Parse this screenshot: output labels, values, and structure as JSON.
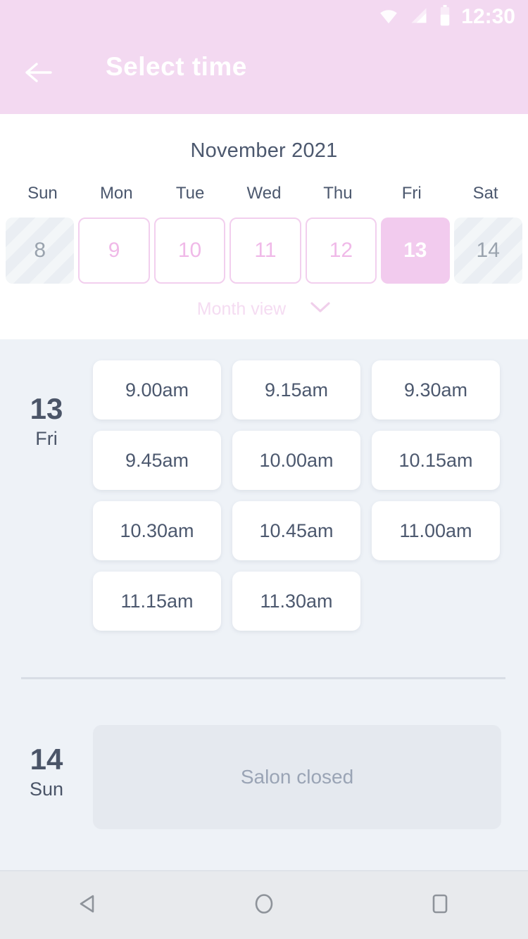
{
  "status_bar": {
    "time": "12:30",
    "icons": [
      "wifi-icon",
      "cellular-signal-icon",
      "battery-icon"
    ]
  },
  "app_bar": {
    "title": "Select time",
    "back_icon": "back-arrow-icon",
    "background_color": "#f3d9f1",
    "title_color": "#ffffff"
  },
  "calendar": {
    "month_title": "November 2021",
    "weekday_headers": [
      "Sun",
      "Mon",
      "Tue",
      "Wed",
      "Thu",
      "Fri",
      "Sat"
    ],
    "days": [
      {
        "number": "8",
        "state": "disabled"
      },
      {
        "number": "9",
        "state": "available"
      },
      {
        "number": "10",
        "state": "available"
      },
      {
        "number": "11",
        "state": "available"
      },
      {
        "number": "12",
        "state": "available"
      },
      {
        "number": "13",
        "state": "selected"
      },
      {
        "number": "14",
        "state": "disabled"
      }
    ],
    "view_toggle_label": "Month view",
    "view_toggle_icon": "chevron-down-icon",
    "selected_color": "#f2cbee",
    "available_border_color": "#f2cfee",
    "disabled_color": "#eaeef3"
  },
  "day_sections": [
    {
      "date_number": "13",
      "weekday": "Fri",
      "slots": [
        "9.00am",
        "9.15am",
        "9.30am",
        "9.45am",
        "10.00am",
        "10.15am",
        "10.30am",
        "10.45am",
        "11.00am",
        "11.15am",
        "11.30am"
      ]
    },
    {
      "date_number": "14",
      "weekday": "Sun",
      "closed_message": "Salon closed"
    }
  ],
  "nav_bar": {
    "buttons": [
      "back-triangle-icon",
      "home-circle-icon",
      "recents-square-icon"
    ]
  }
}
